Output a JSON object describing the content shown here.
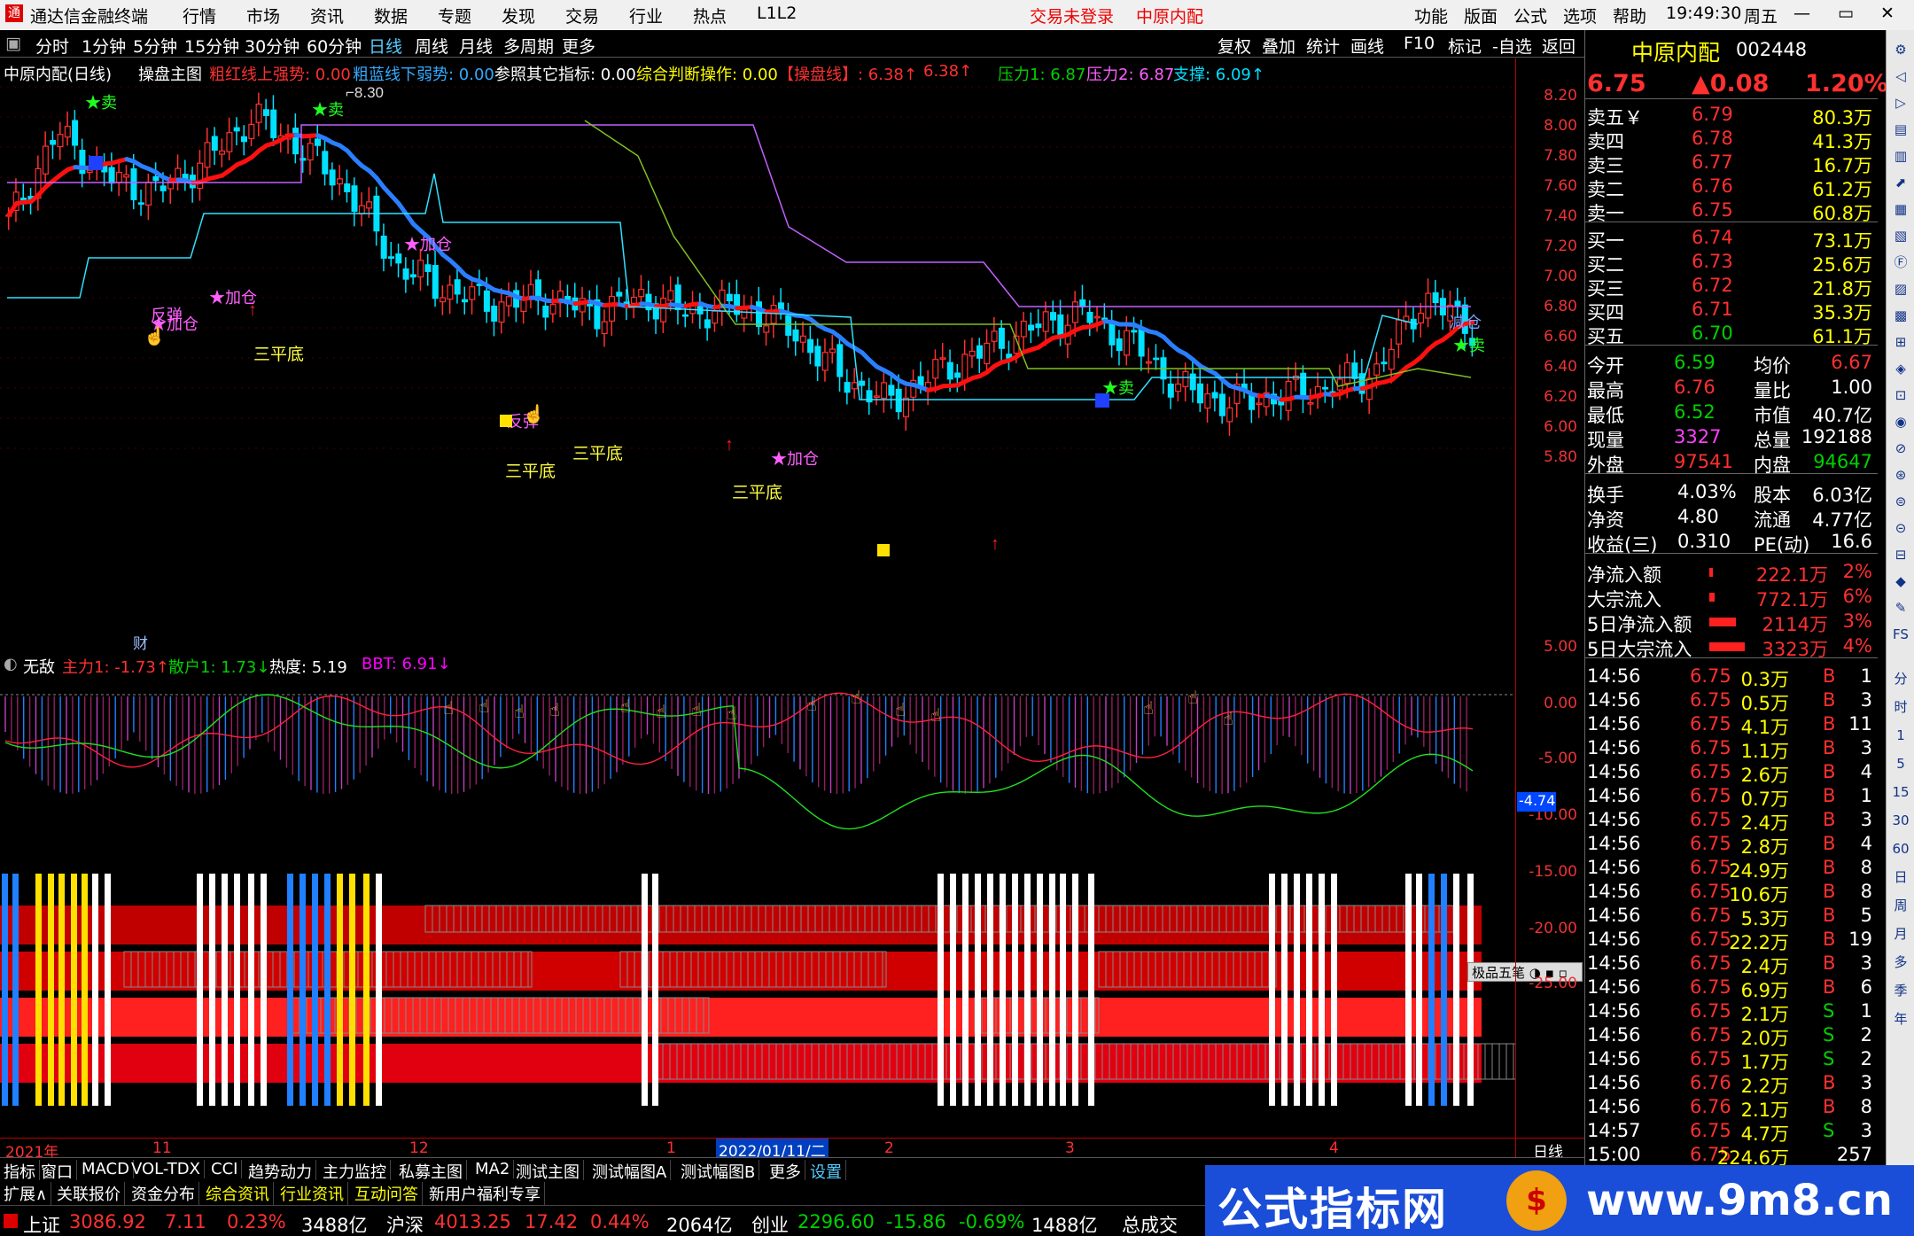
{
  "window": {
    "app_title": "通达信金融终端",
    "menu": [
      "行情",
      "市场",
      "资讯",
      "数据",
      "专题",
      "发现",
      "交易",
      "行业",
      "热点",
      "L1L2"
    ],
    "login_status": "交易未登录",
    "stock_name_title": "中原内配",
    "right_menu": [
      "功能",
      "版面",
      "公式",
      "选项",
      "帮助"
    ],
    "time": "19:49:30",
    "weekday": "周五",
    "controls": {
      "minimize": "—",
      "restore": "▭",
      "close": "✕"
    }
  },
  "periods": [
    "分时",
    "1分钟",
    "5分钟",
    "15分钟",
    "30分钟",
    "60分钟",
    "日线",
    "周线",
    "月线",
    "多周期",
    "更多"
  ],
  "period_active": "日线",
  "tools": [
    "复权",
    "叠加",
    "统计",
    "画线",
    "F10",
    "标记",
    "-自选",
    "返回"
  ],
  "chart_info": {
    "title": "中原内配(日线)",
    "indicator": "操盘主图",
    "red_line": "粗红线上强势: 0.00",
    "blue_line": "粗蓝线下弱势: 0.00",
    "other": "参照其它指标: 0.00",
    "judge": "综合判断操作: 0.00",
    "trade_line": "【操盘线】: 6.38↑",
    "trade_line2": "6.38↑",
    "press1": "压力1: 6.87",
    "press2": "压力2: 6.87",
    "support": "支撑: 6.09↑",
    "high_marker": "8.30"
  },
  "price_axis": [
    "8.20",
    "8.00",
    "7.80",
    "7.60",
    "7.40",
    "7.20",
    "7.00",
    "6.80",
    "6.60",
    "6.40",
    "6.20",
    "6.00",
    "5.80"
  ],
  "sub_axis": [
    "5.00",
    "0.00",
    "-5.00",
    "-10.00",
    "-15.00",
    "-20.00",
    "-25.00"
  ],
  "sub_value_box": "-4.74",
  "annotations": {
    "sell": "卖",
    "add": "加仓",
    "rebound": "反弹",
    "three_bottom": "三平底",
    "reduce": "减仓",
    "cai": "财"
  },
  "sub1": {
    "name": "无敌",
    "main": "主力1: -1.73↑",
    "retail": "散户1: 1.73↓",
    "heat": "热度: 5.19",
    "bbt": "BBT: 6.91↓"
  },
  "sub1_badge": "极品五笔",
  "date_axis": [
    "2021年",
    "11",
    "12",
    "2022/01/11/二",
    "2",
    "3",
    "4"
  ],
  "date_axis_right": "日线",
  "bottom_tabs": [
    "指标",
    "窗口",
    "MACD",
    "VOL-TDX",
    "CCI",
    "趋势动力",
    "主力监控",
    "私募主图",
    "MA2",
    "测试主图",
    "测试幅图A",
    "测试幅图B",
    "更多",
    "设置"
  ],
  "bottom_tabs2": [
    "扩展∧",
    "关联报价",
    "资金分布",
    "综合资讯",
    "行业资讯",
    "互动问答",
    "新用户福利专享"
  ],
  "status": {
    "sh_label": "上证",
    "sh_value": "3086.92",
    "sh_chg": "7.11",
    "sh_pct": "0.23%",
    "sh_amt": "3488亿",
    "sz_label": "沪深",
    "sz_value": "4013.25",
    "sz_chg": "17.42",
    "sz_pct": "0.44%",
    "sz_amt": "2064亿",
    "cy_label": "创业",
    "cy_value": "2296.60",
    "cy_chg": "-15.86",
    "cy_pct": "-0.69%",
    "cy_amt": "1488亿",
    "total": "总成交"
  },
  "quote": {
    "name": "中原内配",
    "code": "002448",
    "price": "6.75",
    "change": "▲0.08",
    "pct": "1.20%",
    "asks": [
      {
        "label": "卖五￥",
        "price": "6.79",
        "vol": "80.3万"
      },
      {
        "label": "卖四",
        "price": "6.78",
        "vol": "41.3万"
      },
      {
        "label": "卖三",
        "price": "6.77",
        "vol": "16.7万"
      },
      {
        "label": "卖二",
        "price": "6.76",
        "vol": "61.2万"
      },
      {
        "label": "卖一",
        "price": "6.75",
        "vol": "60.8万"
      }
    ],
    "bids": [
      {
        "label": "买一",
        "price": "6.74",
        "vol": "73.1万"
      },
      {
        "label": "买二",
        "price": "6.73",
        "vol": "25.6万"
      },
      {
        "label": "买三",
        "price": "6.72",
        "vol": "21.8万"
      },
      {
        "label": "买四",
        "price": "6.71",
        "vol": "35.3万"
      },
      {
        "label": "买五",
        "price": "6.70",
        "vol": "61.1万"
      }
    ],
    "stats": [
      {
        "l1": "今开",
        "v1": "6.59",
        "l2": "均价",
        "v2": "6.67"
      },
      {
        "l1": "最高",
        "v1": "6.76",
        "l2": "量比",
        "v2": "1.00"
      },
      {
        "l1": "最低",
        "v1": "6.52",
        "l2": "市值",
        "v2": "40.7亿"
      },
      {
        "l1": "现量",
        "v1": "3327",
        "l2": "总量",
        "v2": "192188"
      },
      {
        "l1": "外盘",
        "v1": "97541",
        "l2": "内盘",
        "v2": "94647"
      }
    ],
    "fin": [
      {
        "l1": "换手",
        "v1": "4.03%",
        "l2": "股本",
        "v2": "6.03亿"
      },
      {
        "l1": "净资",
        "v1": "4.80",
        "l2": "流通",
        "v2": "4.77亿"
      },
      {
        "l1": "收益(三)",
        "v1": "0.310",
        "l2": "PE(动)",
        "v2": "16.6"
      }
    ],
    "flows": [
      {
        "label": "净流入额",
        "val": "222.1万",
        "pct": "2%",
        "bar": 0.02
      },
      {
        "label": "大宗流入",
        "val": "772.1万",
        "pct": "6%",
        "bar": 0.06
      },
      {
        "label": "5日净流入额",
        "val": "2114万",
        "pct": "3%",
        "bar": 0.3
      },
      {
        "label": "5日大宗流入",
        "val": "3323万",
        "pct": "4%",
        "bar": 0.4
      }
    ],
    "ticks": [
      {
        "t": "14:56",
        "p": "6.75",
        "v": "0.3万",
        "s": "B",
        "n": "1"
      },
      {
        "t": "14:56",
        "p": "6.75",
        "v": "0.5万",
        "s": "B",
        "n": "3"
      },
      {
        "t": "14:56",
        "p": "6.75",
        "v": "4.1万",
        "s": "B",
        "n": "11"
      },
      {
        "t": "14:56",
        "p": "6.75",
        "v": "1.1万",
        "s": "B",
        "n": "3"
      },
      {
        "t": "14:56",
        "p": "6.75",
        "v": "2.6万",
        "s": "B",
        "n": "4"
      },
      {
        "t": "14:56",
        "p": "6.75",
        "v": "0.7万",
        "s": "B",
        "n": "1"
      },
      {
        "t": "14:56",
        "p": "6.75",
        "v": "2.4万",
        "s": "B",
        "n": "3"
      },
      {
        "t": "14:56",
        "p": "6.75",
        "v": "2.8万",
        "s": "B",
        "n": "4"
      },
      {
        "t": "14:56",
        "p": "6.75",
        "v": "24.9万",
        "s": "B",
        "n": "8"
      },
      {
        "t": "14:56",
        "p": "6.75",
        "v": "10.6万",
        "s": "B",
        "n": "8"
      },
      {
        "t": "14:56",
        "p": "6.75",
        "v": "5.3万",
        "s": "B",
        "n": "5"
      },
      {
        "t": "14:56",
        "p": "6.75",
        "v": "22.2万",
        "s": "B",
        "n": "19"
      },
      {
        "t": "14:56",
        "p": "6.75",
        "v": "2.4万",
        "s": "B",
        "n": "3"
      },
      {
        "t": "14:56",
        "p": "6.75",
        "v": "6.9万",
        "s": "B",
        "n": "6"
      },
      {
        "t": "14:56",
        "p": "6.75",
        "v": "2.1万",
        "s": "S",
        "n": "1"
      },
      {
        "t": "14:56",
        "p": "6.75",
        "v": "2.0万",
        "s": "S",
        "n": "2"
      },
      {
        "t": "14:56",
        "p": "6.75",
        "v": "1.7万",
        "s": "S",
        "n": "2"
      },
      {
        "t": "14:56",
        "p": "6.76",
        "v": "2.2万",
        "s": "B",
        "n": "3"
      },
      {
        "t": "14:56",
        "p": "6.76",
        "v": "2.1万",
        "s": "B",
        "n": "8"
      },
      {
        "t": "14:57",
        "p": "6.75",
        "v": "4.7万",
        "s": "S",
        "n": "3"
      },
      {
        "t": "15:00",
        "p": "6.75",
        "v": "224.6万",
        "s": "",
        "n": "257"
      }
    ]
  },
  "right_toolbar": [
    "分",
    "时",
    "1",
    "5",
    "15",
    "30",
    "60",
    "日",
    "周",
    "月",
    "多",
    "季",
    "年"
  ],
  "brand": {
    "text": "公式指标网",
    "url": "www.9m8.cn"
  }
}
